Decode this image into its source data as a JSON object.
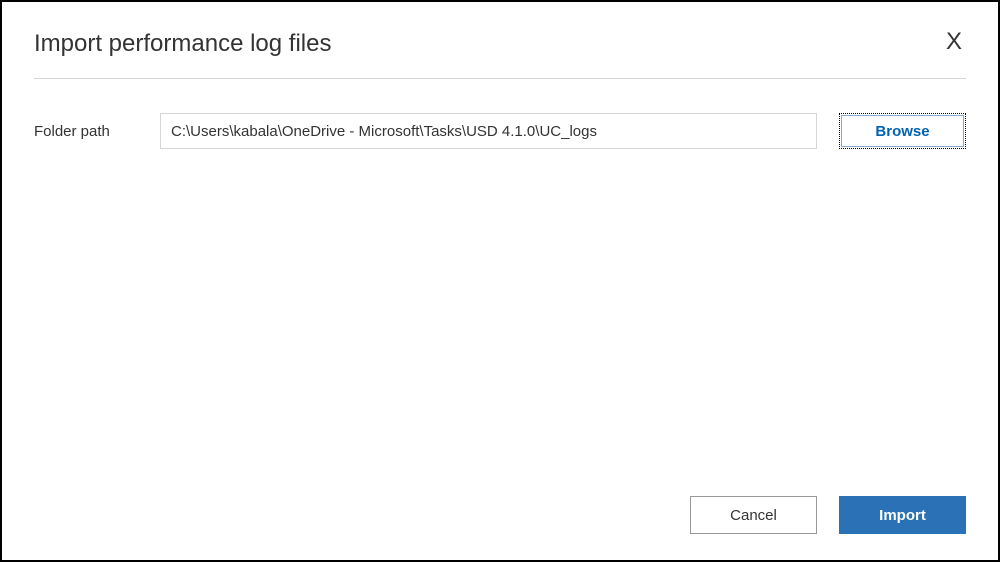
{
  "dialog": {
    "title": "Import performance log files",
    "close_label": "X"
  },
  "form": {
    "folder_path_label": "Folder path",
    "folder_path_value": "C:\\Users\\kabala\\OneDrive - Microsoft\\Tasks\\USD 4.1.0\\UC_logs",
    "browse_label": "Browse"
  },
  "footer": {
    "cancel_label": "Cancel",
    "import_label": "Import"
  },
  "colors": {
    "primary": "#2a72b5",
    "link": "#0063b1",
    "border": "#d6d6d6",
    "text": "#333333"
  }
}
